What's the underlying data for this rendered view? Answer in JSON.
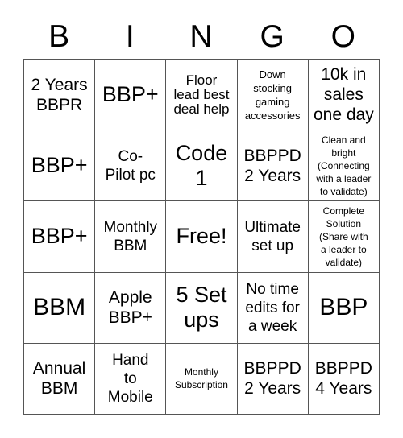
{
  "header": {
    "letters": [
      "B",
      "I",
      "N",
      "G",
      "O"
    ]
  },
  "rows": [
    {
      "cells": [
        {
          "text": "2 Years\nBBPR",
          "size": "fs-m"
        },
        {
          "text": "BBP+",
          "size": "fs-l"
        },
        {
          "text": "Floor\nlead best\ndeal help",
          "size": "fs-s"
        },
        {
          "text": "Down\nstocking\ngaming\naccessories",
          "size": "fs-xs"
        },
        {
          "text": "10k in\nsales\none day",
          "size": "fs-m"
        }
      ]
    },
    {
      "cells": [
        {
          "text": "BBP+",
          "size": "fs-l"
        },
        {
          "text": "Co-\nPilot pc",
          "size": "fs-ms"
        },
        {
          "text": "Code\n1",
          "size": "fs-l"
        },
        {
          "text": "BBPPD\n2 Years",
          "size": "fs-m"
        },
        {
          "text": "Clean and\nbright\n(Connecting\nwith a leader\nto validate)",
          "size": "fs-xxs"
        }
      ]
    },
    {
      "cells": [
        {
          "text": "BBP+",
          "size": "fs-l"
        },
        {
          "text": "Monthly\nBBM",
          "size": "fs-ms"
        },
        {
          "text": "Free!",
          "size": "fs-l"
        },
        {
          "text": "Ultimate\nset up",
          "size": "fs-ms"
        },
        {
          "text": "Complete\nSolution\n(Share with\na leader to\nvalidate)",
          "size": "fs-xxs"
        }
      ]
    },
    {
      "cells": [
        {
          "text": "BBM",
          "size": "fs-xl"
        },
        {
          "text": "Apple\nBBP+",
          "size": "fs-m"
        },
        {
          "text": "5 Set\nups",
          "size": "fs-l"
        },
        {
          "text": "No time\nedits for\na week",
          "size": "fs-ms"
        },
        {
          "text": "BBP",
          "size": "fs-xl"
        }
      ]
    },
    {
      "cells": [
        {
          "text": "Annual\nBBM",
          "size": "fs-m"
        },
        {
          "text": "Hand\nto\nMobile",
          "size": "fs-ms"
        },
        {
          "text": "Monthly\nSubscription",
          "size": "fs-xxs"
        },
        {
          "text": "BBPPD\n2 Years",
          "size": "fs-m"
        },
        {
          "text": "BBPPD\n4 Years",
          "size": "fs-m"
        }
      ]
    }
  ]
}
